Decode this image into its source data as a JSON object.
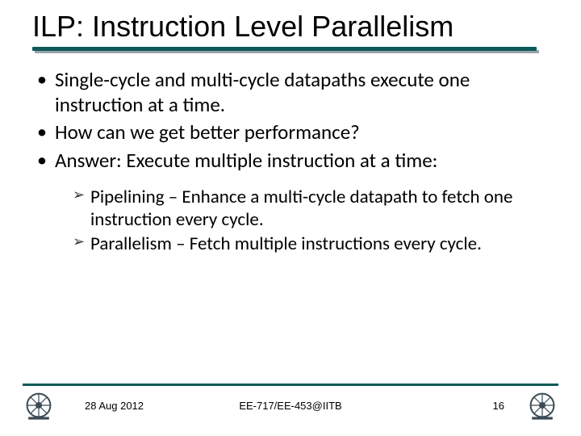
{
  "title": "ILP: Instruction Level Parallelism",
  "bullets": {
    "main": [
      "Single-cycle and multi-cycle datapaths execute one instruction at a time.",
      "How can we get better performance?",
      "Answer: Execute multiple instruction at a time:"
    ],
    "sub": [
      "Pipelining – Enhance a multi-cycle datapath to fetch one instruction every cycle.",
      "Parallelism – Fetch multiple instructions every cycle."
    ]
  },
  "footer": {
    "date": "28 Aug 2012",
    "course": "EE-717/EE-453@IITB",
    "page": "16"
  },
  "colors": {
    "accent": "#0e5a5a"
  }
}
